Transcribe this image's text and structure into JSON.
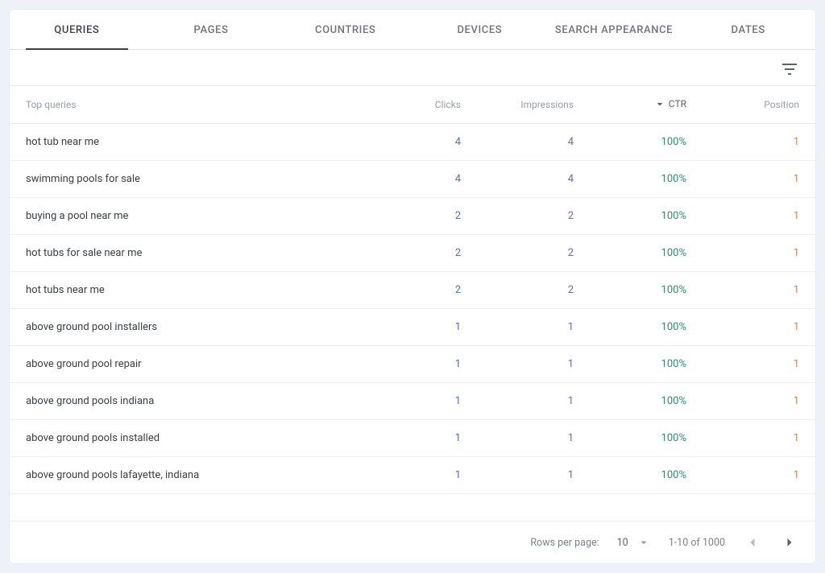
{
  "tabs": {
    "queries": "QUERIES",
    "pages": "PAGES",
    "countries": "COUNTRIES",
    "devices": "DEVICES",
    "search_appearance": "SEARCH APPEARANCE",
    "dates": "DATES"
  },
  "table": {
    "headers": {
      "query": "Top queries",
      "clicks": "Clicks",
      "impressions": "Impressions",
      "ctr": "CTR",
      "position": "Position"
    },
    "rows": [
      {
        "query": "hot tub near me",
        "clicks": "4",
        "impressions": "4",
        "ctr": "100%",
        "position": "1"
      },
      {
        "query": "swimming pools for sale",
        "clicks": "4",
        "impressions": "4",
        "ctr": "100%",
        "position": "1"
      },
      {
        "query": "buying a pool near me",
        "clicks": "2",
        "impressions": "2",
        "ctr": "100%",
        "position": "1"
      },
      {
        "query": "hot tubs for sale near me",
        "clicks": "2",
        "impressions": "2",
        "ctr": "100%",
        "position": "1"
      },
      {
        "query": "hot tubs near me",
        "clicks": "2",
        "impressions": "2",
        "ctr": "100%",
        "position": "1"
      },
      {
        "query": "above ground pool installers",
        "clicks": "1",
        "impressions": "1",
        "ctr": "100%",
        "position": "1"
      },
      {
        "query": "above ground pool repair",
        "clicks": "1",
        "impressions": "1",
        "ctr": "100%",
        "position": "1"
      },
      {
        "query": "above ground pools indiana",
        "clicks": "1",
        "impressions": "1",
        "ctr": "100%",
        "position": "1"
      },
      {
        "query": "above ground pools installed",
        "clicks": "1",
        "impressions": "1",
        "ctr": "100%",
        "position": "1"
      },
      {
        "query": "above ground pools lafayette, indiana",
        "clicks": "1",
        "impressions": "1",
        "ctr": "100%",
        "position": "1"
      }
    ]
  },
  "footer": {
    "rows_per_page_label": "Rows per page:",
    "rows_per_page_value": "10",
    "range": "1-10 of 1000"
  }
}
